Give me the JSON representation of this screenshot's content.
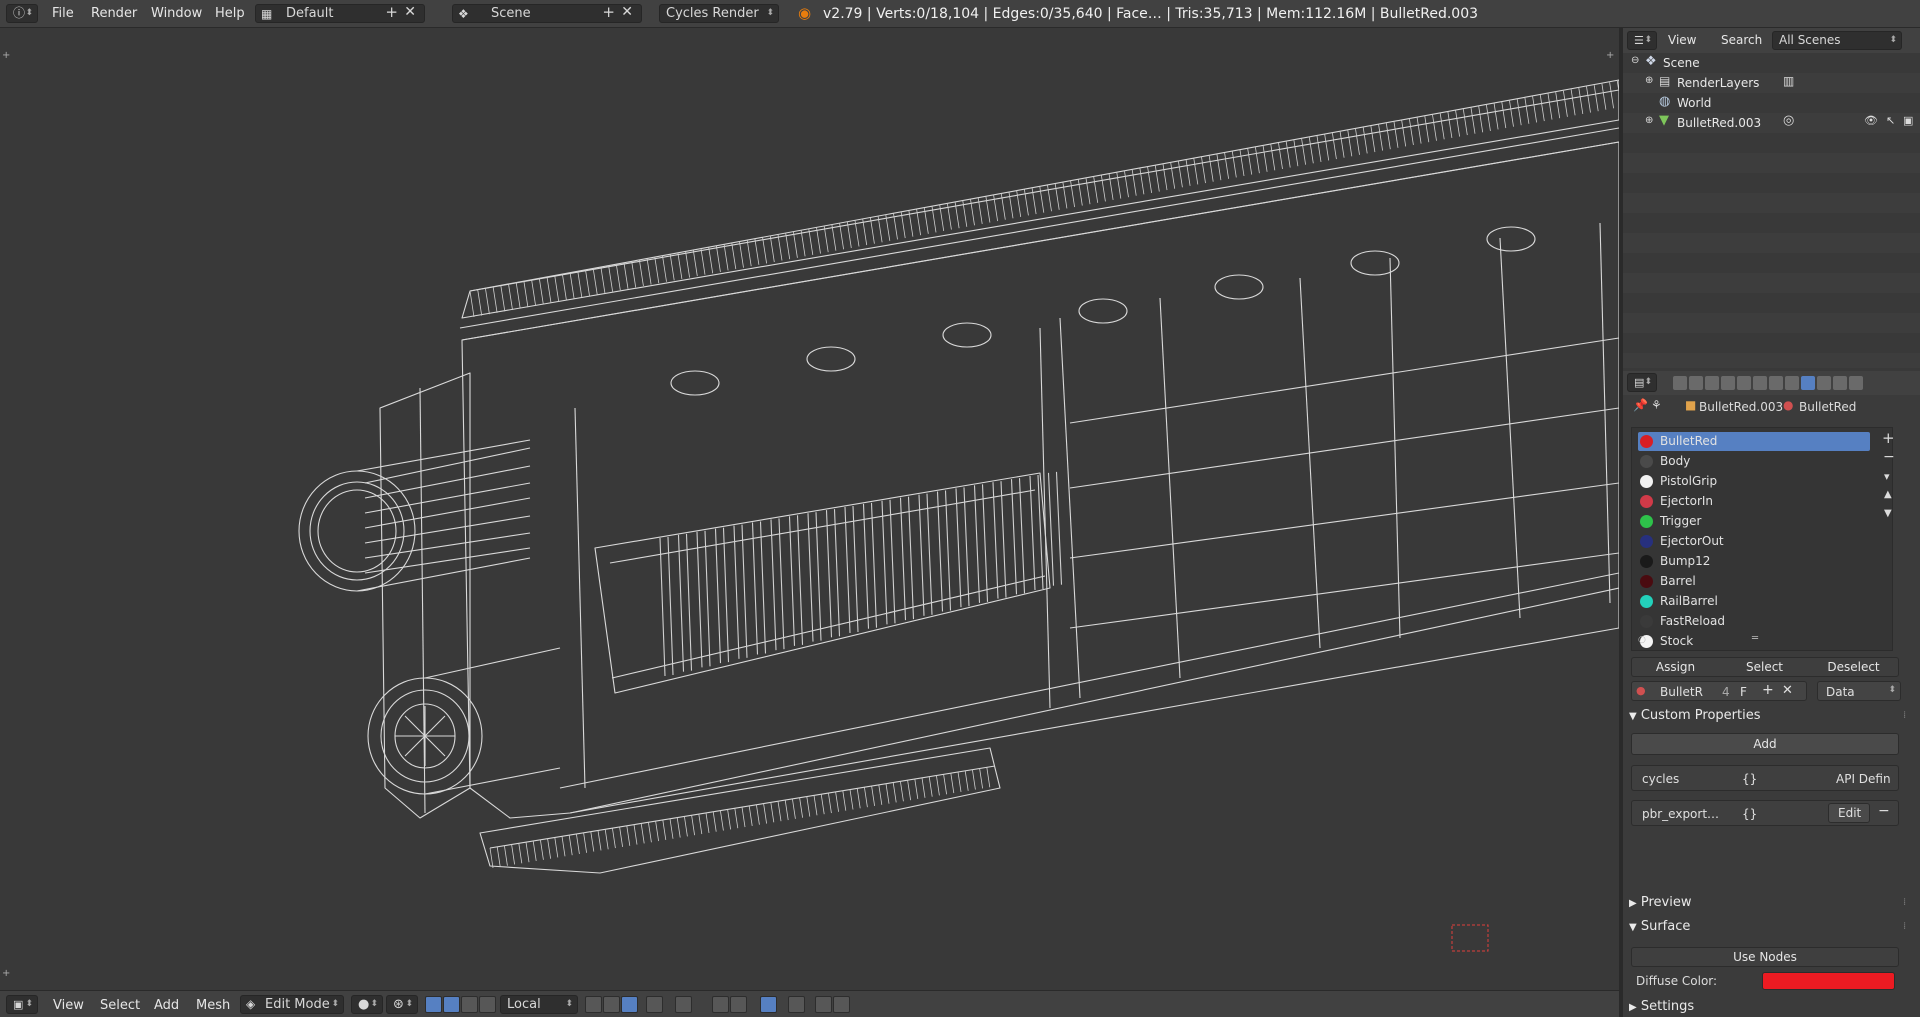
{
  "topbar": {
    "menus": [
      "File",
      "Render",
      "Window",
      "Help"
    ],
    "screen_layout": "Default",
    "scene": "Scene",
    "render_engine": "Cycles Render",
    "stats": "v2.79 | Verts:0/18,104 | Edges:0/35,640 | Face… | Tris:35,713 | Mem:112.16M | BulletRed.003"
  },
  "outliner": {
    "header": {
      "view": "View",
      "search": "Search",
      "scope": "All Scenes"
    },
    "items": [
      {
        "label": "Scene",
        "icon": "scene-icon"
      },
      {
        "label": "RenderLayers",
        "icon": "render-layers-icon"
      },
      {
        "label": "World",
        "icon": "world-icon"
      },
      {
        "label": "BulletRed.003",
        "icon": "mesh-object-icon"
      }
    ]
  },
  "properties": {
    "breadcrumb": {
      "object": "BulletRed.003",
      "material": "BulletRed"
    },
    "materials": [
      {
        "name": "BulletRed",
        "color": "#d91e25",
        "selected": true
      },
      {
        "name": "Body",
        "color": "#4a4a4a"
      },
      {
        "name": "PistolGrip",
        "color": "#f2f2f2"
      },
      {
        "name": "EjectorIn",
        "color": "#d03a48"
      },
      {
        "name": "Trigger",
        "color": "#2ec24a"
      },
      {
        "name": "EjectorOut",
        "color": "#27307e"
      },
      {
        "name": "Bump12",
        "color": "#1a1a1a"
      },
      {
        "name": "Barrel",
        "color": "#4a0b10"
      },
      {
        "name": "RailBarrel",
        "color": "#23d1bb"
      },
      {
        "name": "FastReload",
        "color": "#3a3a3a"
      },
      {
        "name": "Stock",
        "color": "#f4f4f4"
      }
    ],
    "slot_buttons": {
      "assign": "Assign",
      "select": "Select",
      "deselect": "Deselect"
    },
    "datablock": {
      "name": "BulletR",
      "users": "4",
      "fake": "F",
      "link": "Data"
    },
    "custom_properties": {
      "title": "Custom Properties",
      "add": "Add",
      "props": [
        {
          "name": "cycles",
          "value": "{}",
          "extra": "API Defin"
        },
        {
          "name": "pbr_export…",
          "value": "{}",
          "extra": "Edit"
        }
      ]
    },
    "preview": "Preview",
    "surface": {
      "title": "Surface",
      "use_nodes": "Use Nodes",
      "diffuse_label": "Diffuse Color:",
      "diffuse_color": "#ec1b22"
    },
    "settings": "Settings"
  },
  "bottombar": {
    "menus": [
      "View",
      "Select",
      "Add",
      "Mesh"
    ],
    "mode": "Edit Mode",
    "pivot_space": "Local"
  }
}
